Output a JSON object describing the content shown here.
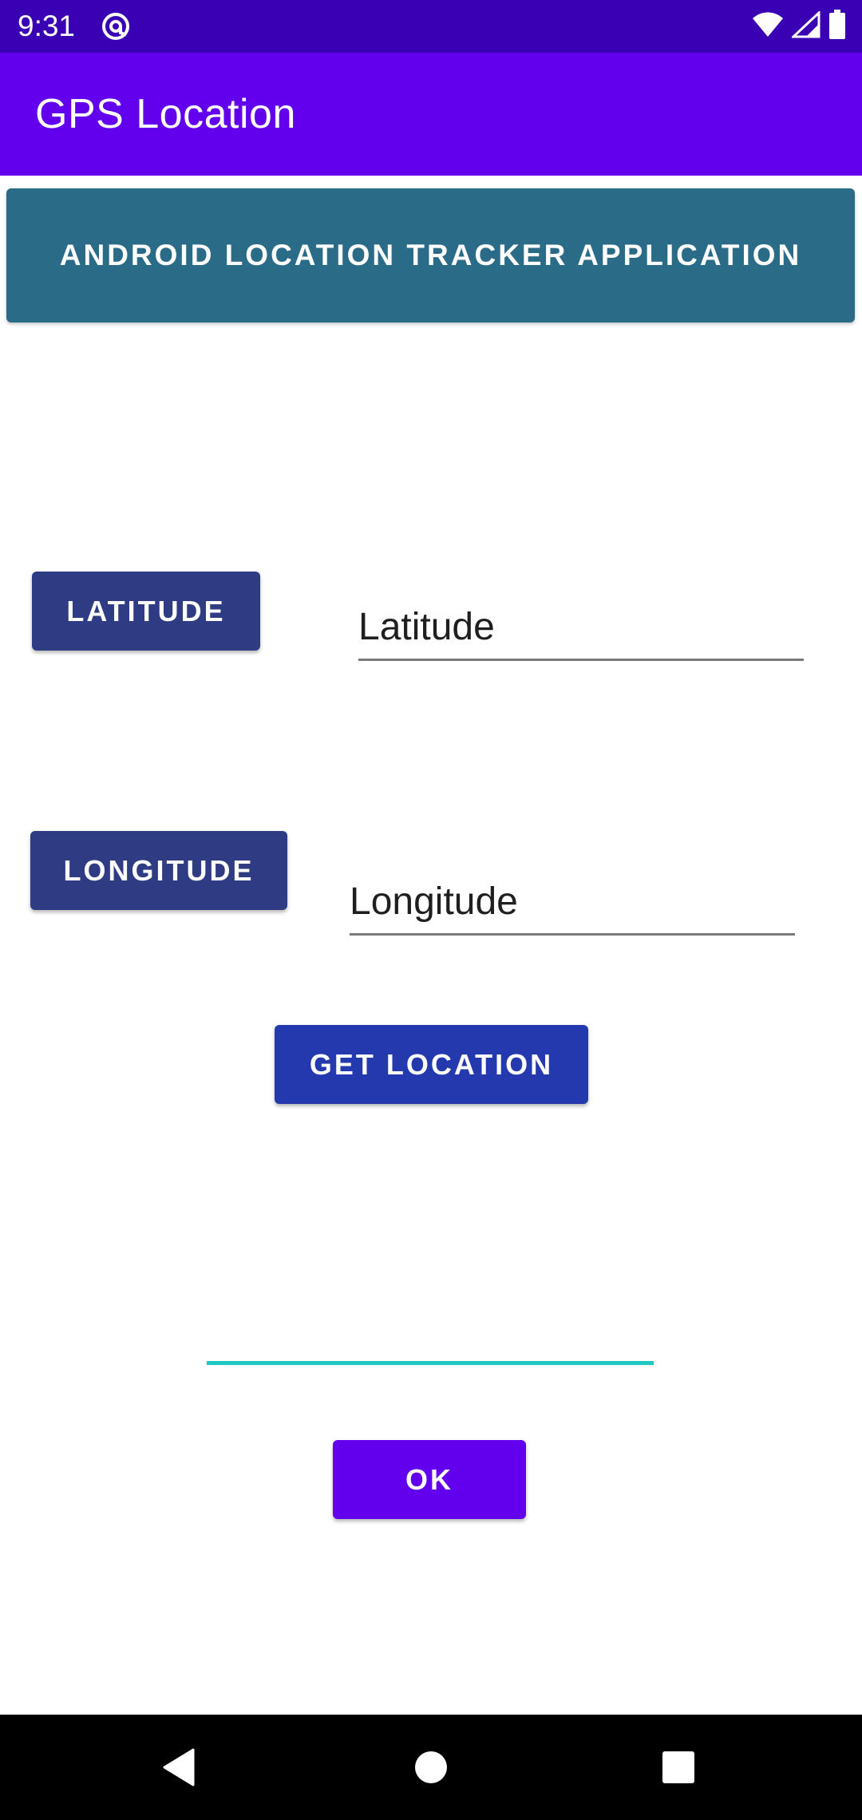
{
  "status_bar": {
    "time": "9:31",
    "app_icon": "at-sign-icon",
    "icons": [
      "wifi-icon",
      "cell-signal-icon",
      "battery-icon"
    ],
    "color": "#3a00b3"
  },
  "app_bar": {
    "title": "GPS Location",
    "color": "#6200ee"
  },
  "banner": {
    "label": "ANDROID LOCATION TRACKER APPLICATION",
    "color": "#2a6b88"
  },
  "latitude": {
    "button_label": "LATITUDE",
    "field_value": "Latitude"
  },
  "longitude": {
    "button_label": "LONGITUDE",
    "field_value": "Longitude"
  },
  "get_location": {
    "label": "GET LOCATION",
    "color": "#2439ad"
  },
  "result_field": {
    "value": "",
    "underline_color": "#1fc8c0"
  },
  "ok_button": {
    "label": "OK",
    "color": "#6200ee"
  },
  "nav_bar": {
    "items": [
      "back-icon",
      "home-icon",
      "recents-icon"
    ]
  }
}
